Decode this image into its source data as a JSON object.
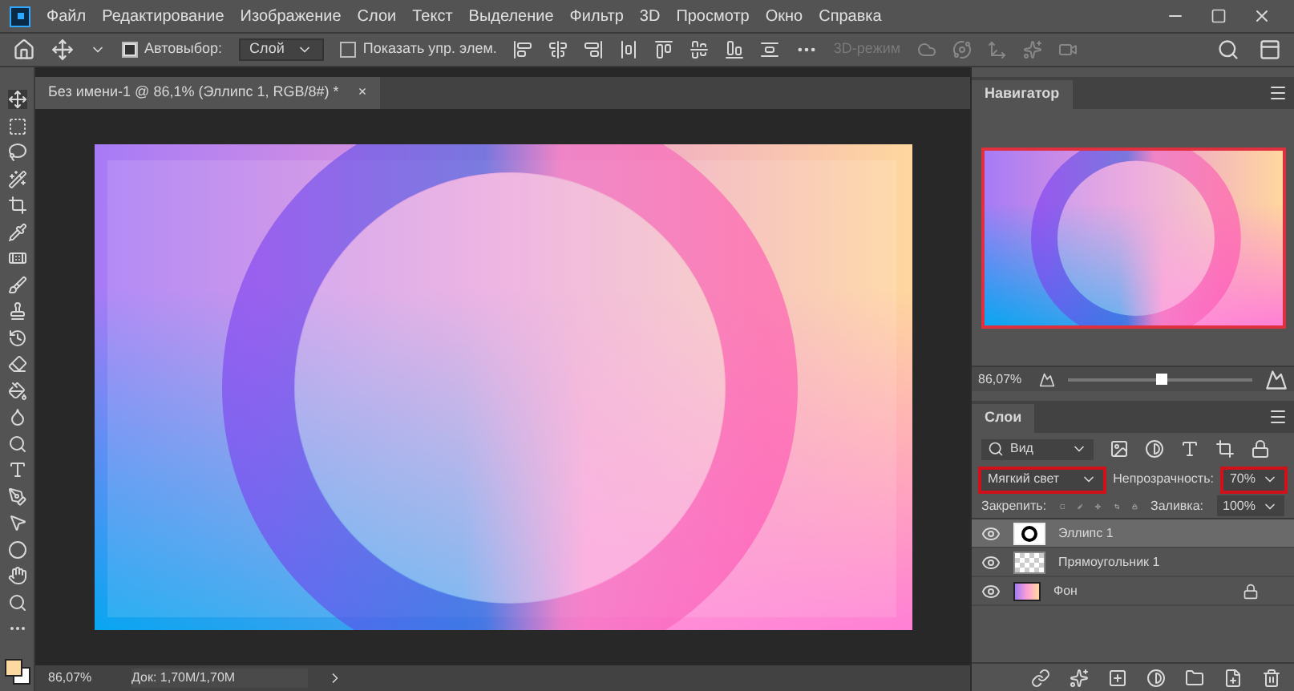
{
  "menu": [
    "Файл",
    "Редактирование",
    "Изображение",
    "Слои",
    "Текст",
    "Выделение",
    "Фильтр",
    "3D",
    "Просмотр",
    "Окно",
    "Справка"
  ],
  "options": {
    "autoselect": {
      "label": "Автовыбор:",
      "checked": true
    },
    "target": "Слой",
    "show_transform": {
      "label": "Показать упр. элем.",
      "checked": false
    },
    "mode_3d": {
      "label": "3D-режим",
      "disabled": true
    }
  },
  "document_tab": {
    "title": "Без имени-1 @ 86,1% (Эллипс 1, RGB/8#) *",
    "close": "×"
  },
  "status_bar": {
    "zoom": "86,07%",
    "doc": "Док: 1,70M/1,70M"
  },
  "navigator": {
    "tab": "Навигатор",
    "zoom": "86,07%",
    "level": 0.5
  },
  "layers_panel": {
    "tab": "Слои",
    "filter": "Вид",
    "blend_mode": {
      "value": "Мягкий свет",
      "highlighted": true
    },
    "opacity": {
      "label": "Непрозрачность:",
      "value": "70%",
      "highlighted": true
    },
    "lock_label": "Закрепить:",
    "fill": {
      "label": "Заливка:",
      "value": "100%"
    },
    "layers": [
      {
        "name": "Эллипс 1",
        "kind": "ellipse",
        "selected": true,
        "visible": true,
        "locked": false
      },
      {
        "name": "Прямоугольник 1",
        "kind": "rectangle",
        "selected": false,
        "visible": true,
        "locked": false
      },
      {
        "name": "Фон",
        "kind": "background",
        "selected": false,
        "visible": true,
        "locked": true
      }
    ]
  }
}
